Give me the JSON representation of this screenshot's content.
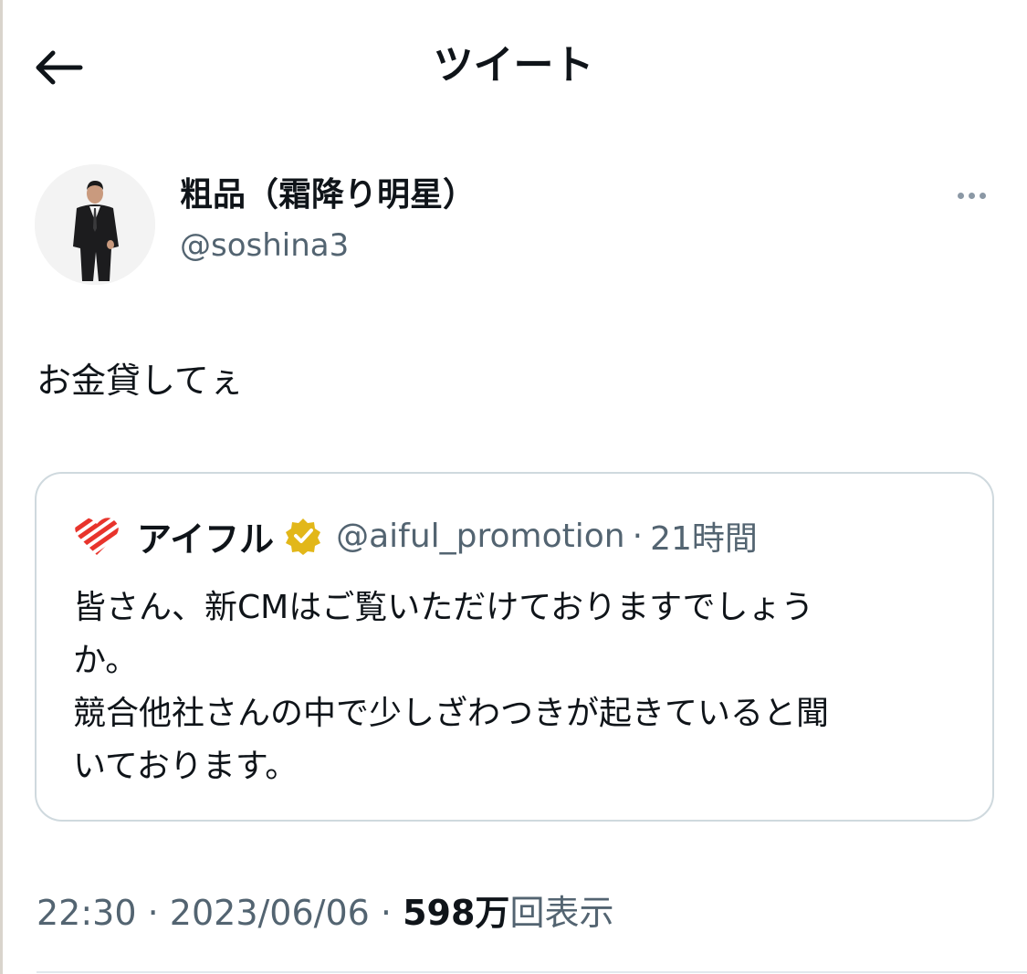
{
  "header": {
    "title": "ツイート",
    "back_icon": "arrow-left-icon"
  },
  "author": {
    "display_name": "粗品（霜降り明星）",
    "handle": "@soshina3",
    "more_icon": "more-horizontal-icon"
  },
  "tweet": {
    "text": "お金貸してぇ"
  },
  "quote": {
    "logo_icon": "aiful-heart-logo",
    "name": "アイフル",
    "verified_icon": "gold-verified-badge-icon",
    "handle": "@aiful_promotion",
    "separator": "·",
    "time": "21時間",
    "lines": [
      "皆さん、新CMはご覧いただけておりますでしょう",
      "か。",
      "競合他社さんの中で少しざわつきが起きていると聞",
      "いております。"
    ]
  },
  "meta": {
    "time": "22:30",
    "separator": "·",
    "date": "2023/06/06",
    "views_count": "598万",
    "views_label": "回表示"
  },
  "colors": {
    "text_primary": "#0f1419",
    "text_secondary": "#536471",
    "border": "#cfd9de",
    "verified_gold": "#e2b719",
    "logo_red": "#e8342c"
  }
}
